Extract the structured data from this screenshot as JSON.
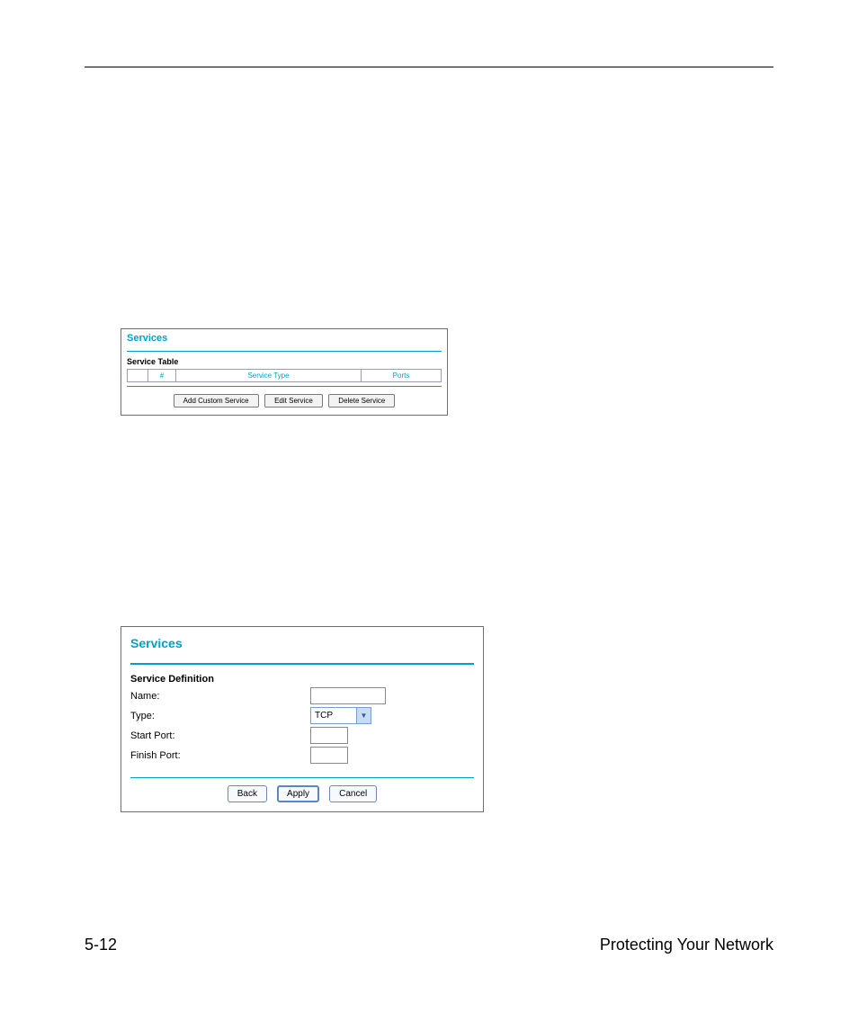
{
  "page": {
    "number": "5-12",
    "section_title": "Protecting Your Network"
  },
  "panel1": {
    "title": "Services",
    "subtitle": "Service Table",
    "columns": {
      "num": "#",
      "type": "Service Type",
      "ports": "Ports"
    },
    "buttons": {
      "add": "Add Custom Service",
      "edit": "Edit Service",
      "delete": "Delete Service"
    }
  },
  "panel2": {
    "title": "Services",
    "section": "Service Definition",
    "fields": {
      "name_label": "Name:",
      "type_label": "Type:",
      "type_value": "TCP",
      "start_label": "Start Port:",
      "finish_label": "Finish Port:"
    },
    "buttons": {
      "back": "Back",
      "apply": "Apply",
      "cancel": "Cancel"
    }
  }
}
